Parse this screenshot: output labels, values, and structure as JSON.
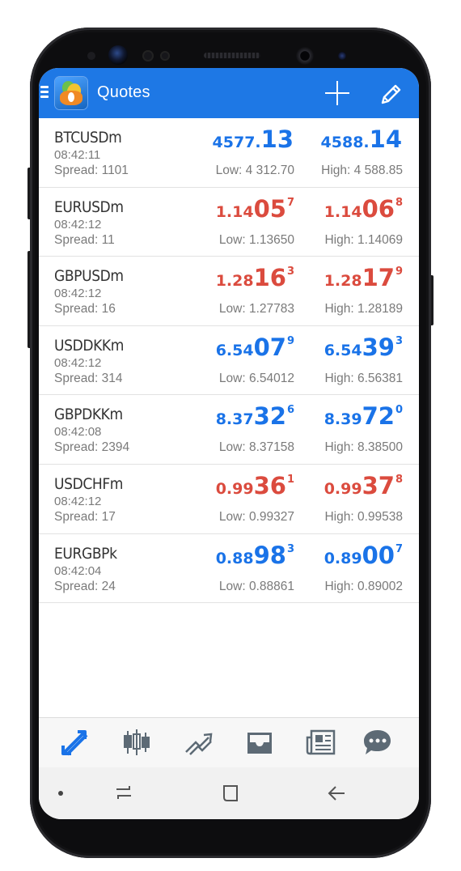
{
  "app": {
    "title": "Quotes"
  },
  "colors": {
    "appbar": "#1e78e5",
    "up": "#1a73e8",
    "down": "#db4b3e"
  },
  "icons": {
    "appbar": [
      "menu-icon",
      "metatrader-logo-icon",
      "plus-icon",
      "pencil-icon"
    ],
    "bottom_nav": [
      "quotes-icon",
      "chart-icon",
      "trade-icon",
      "history-icon",
      "news-icon",
      "chat-icon"
    ],
    "system_nav": [
      "dot-icon",
      "recent-apps-icon",
      "home-icon",
      "back-icon"
    ]
  },
  "quotes": [
    {
      "symbol": "BTCUSDm",
      "time": "08:42:11",
      "spread": "Spread: 1101",
      "dir": "up",
      "bid": {
        "a": "4577.",
        "b": "13",
        "c": ""
      },
      "ask": {
        "a": "4588.",
        "b": "14",
        "c": ""
      },
      "low": "Low: 4 312.70",
      "high": "High: 4 588.85"
    },
    {
      "symbol": "EURUSDm",
      "time": "08:42:12",
      "spread": "Spread: 11",
      "dir": "down",
      "bid": {
        "a": "1.14",
        "b": "05",
        "c": "7"
      },
      "ask": {
        "a": "1.14",
        "b": "06",
        "c": "8"
      },
      "low": "Low: 1.13650",
      "high": "High: 1.14069"
    },
    {
      "symbol": "GBPUSDm",
      "time": "08:42:12",
      "spread": "Spread: 16",
      "dir": "down",
      "bid": {
        "a": "1.28",
        "b": "16",
        "c": "3"
      },
      "ask": {
        "a": "1.28",
        "b": "17",
        "c": "9"
      },
      "low": "Low: 1.27783",
      "high": "High: 1.28189"
    },
    {
      "symbol": "USDDKKm",
      "time": "08:42:12",
      "spread": "Spread: 314",
      "dir": "up",
      "bid": {
        "a": "6.54",
        "b": "07",
        "c": "9"
      },
      "ask": {
        "a": "6.54",
        "b": "39",
        "c": "3"
      },
      "low": "Low: 6.54012",
      "high": "High: 6.56381"
    },
    {
      "symbol": "GBPDKKm",
      "time": "08:42:08",
      "spread": "Spread: 2394",
      "dir": "up",
      "bid": {
        "a": "8.37",
        "b": "32",
        "c": "6"
      },
      "ask": {
        "a": "8.39",
        "b": "72",
        "c": "0"
      },
      "low": "Low: 8.37158",
      "high": "High: 8.38500"
    },
    {
      "symbol": "USDCHFm",
      "time": "08:42:12",
      "spread": "Spread: 17",
      "dir": "down",
      "bid": {
        "a": "0.99",
        "b": "36",
        "c": "1"
      },
      "ask": {
        "a": "0.99",
        "b": "37",
        "c": "8"
      },
      "low": "Low: 0.99327",
      "high": "High: 0.99538"
    },
    {
      "symbol": "EURGBPk",
      "time": "08:42:04",
      "spread": "Spread: 24",
      "dir": "up",
      "bid": {
        "a": "0.88",
        "b": "98",
        "c": "3"
      },
      "ask": {
        "a": "0.89",
        "b": "00",
        "c": "7"
      },
      "low": "Low: 0.88861",
      "high": "High: 0.89002"
    }
  ]
}
